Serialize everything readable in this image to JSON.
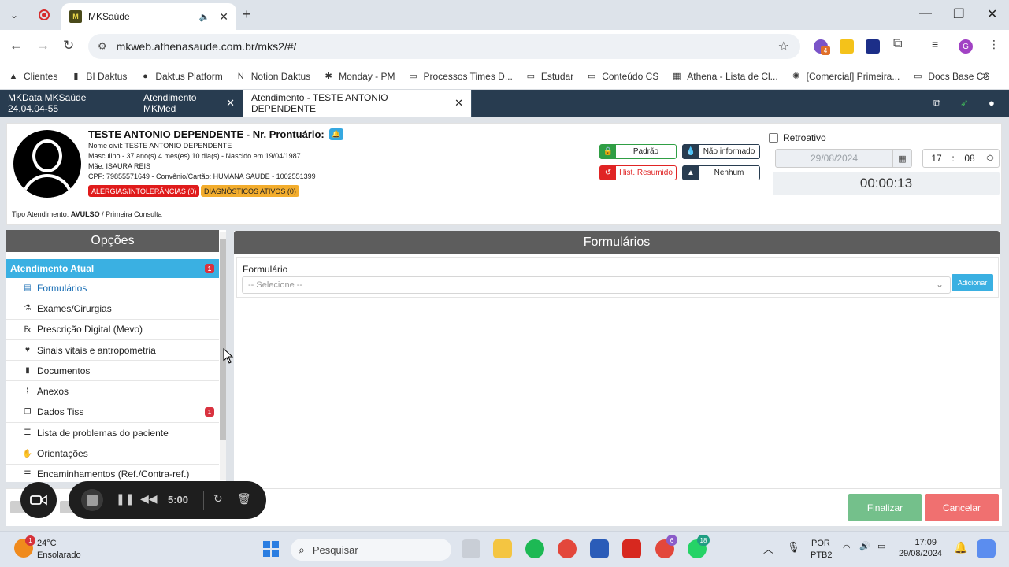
{
  "browser": {
    "tab_title": "MKSaúde",
    "url": "mkweb.athenasaude.com.br/mks2/#/",
    "extension_badge": "4"
  },
  "bookmarks": [
    {
      "label": "Clientes",
      "icon": "google-drive-icon"
    },
    {
      "label": "BI Daktus",
      "icon": "bi-icon"
    },
    {
      "label": "Daktus Platform",
      "icon": "circle-icon"
    },
    {
      "label": "Notion Daktus",
      "icon": "notion-icon"
    },
    {
      "label": "Monday - PM",
      "icon": "monday-icon"
    },
    {
      "label": "Processos Times D...",
      "icon": "folder-icon"
    },
    {
      "label": "Estudar",
      "icon": "folder-icon"
    },
    {
      "label": "Conteúdo CS",
      "icon": "folder-icon"
    },
    {
      "label": "Athena - Lista de Cl...",
      "icon": "sheets-icon"
    },
    {
      "label": "[Comercial] Primeira...",
      "icon": "gear-icon"
    },
    {
      "label": "Docs Base CS",
      "icon": "folder-icon"
    }
  ],
  "app_tabs": [
    {
      "label": "MKData MKSaúde 24.04.04-55",
      "closable": false
    },
    {
      "label": "Atendimento MKMed",
      "closable": true
    },
    {
      "label": "Atendimento - TESTE ANTONIO DEPENDENTE",
      "closable": true
    }
  ],
  "patient": {
    "name_line": "TESTE ANTONIO DEPENDENTE - Nr. Prontuário:",
    "civil_name": "Nome civil: TESTE ANTONIO DEPENDENTE",
    "age_line": "Masculino - 37 ano(s) 4 mes(es) 10 dia(s) - Nascido em 19/04/1987",
    "mother": "Mãe: ISAURA REIS",
    "cpf_line": "CPF: 79855571649 - Convênio/Cartão: HUMANA SAUDE - 1002551399",
    "allergies_tag": "ALERGIAS/INTOLERÂNCIAS (0)",
    "diagnoses_tag": "DIAGNÓSTICOS ATIVOS (0)",
    "tipo_label": "Tipo Atendimento:",
    "tipo_value": "AVULSO",
    "tipo_extra": "/ Primeira Consulta"
  },
  "status_buttons": {
    "padrao": "Padrão",
    "nao_informado": "Não informado",
    "hist_resumido": "Hist. Resumido",
    "nenhum": "Nenhum"
  },
  "datetime": {
    "retroativo_label": "Retroativo",
    "date": "29/08/2024",
    "hour": "17",
    "minute": "08",
    "timer": "00:00:13"
  },
  "sidebar": {
    "title": "Opções",
    "section": "Atendimento Atual",
    "section_badge": "1",
    "items": [
      {
        "label": "Formulários",
        "icon": "document-icon",
        "badge": ""
      },
      {
        "label": "Exames/Cirurgias",
        "icon": "flask-icon",
        "badge": ""
      },
      {
        "label": "Prescrição Digital (Mevo)",
        "icon": "prescription-icon",
        "badge": ""
      },
      {
        "label": "Sinais vitais e antropometria",
        "icon": "heartbeat-icon",
        "badge": ""
      },
      {
        "label": "Documentos",
        "icon": "file-icon",
        "badge": ""
      },
      {
        "label": "Anexos",
        "icon": "paperclip-icon",
        "badge": ""
      },
      {
        "label": "Dados Tiss",
        "icon": "copy-icon",
        "badge": "1"
      },
      {
        "label": "Lista de problemas do paciente",
        "icon": "list-icon",
        "badge": ""
      },
      {
        "label": "Orientações",
        "icon": "hand-icon",
        "badge": ""
      },
      {
        "label": "Encaminhamentos (Ref./Contra-ref.)",
        "icon": "list-indent-icon",
        "badge": ""
      }
    ]
  },
  "main": {
    "title": "Formulários",
    "form_label": "Formulário",
    "select_placeholder": "-- Selecione --",
    "add_button": "Adicionar"
  },
  "footer": {
    "finalizar": "Finalizar",
    "cancelar": "Cancelar"
  },
  "recorder": {
    "time": "5:00"
  },
  "taskbar": {
    "temperature": "24°C",
    "weather": "Ensolarado",
    "search_placeholder": "Pesquisar",
    "lang1": "POR",
    "lang2": "PTB2",
    "time": "17:09",
    "date": "29/08/2024",
    "chrome_badge": "6",
    "whatsapp_badge": "18",
    "weather_badge": "1"
  },
  "colors": {
    "app_nav": "#283c50",
    "accent_blue": "#3ab0e2",
    "finalizar_green": "#74c08b",
    "cancelar_red": "#f07070",
    "allergy_red": "#e01b1b",
    "diagnosis_yellow": "#f3ad2d",
    "panel_header": "#5d5d5d"
  }
}
